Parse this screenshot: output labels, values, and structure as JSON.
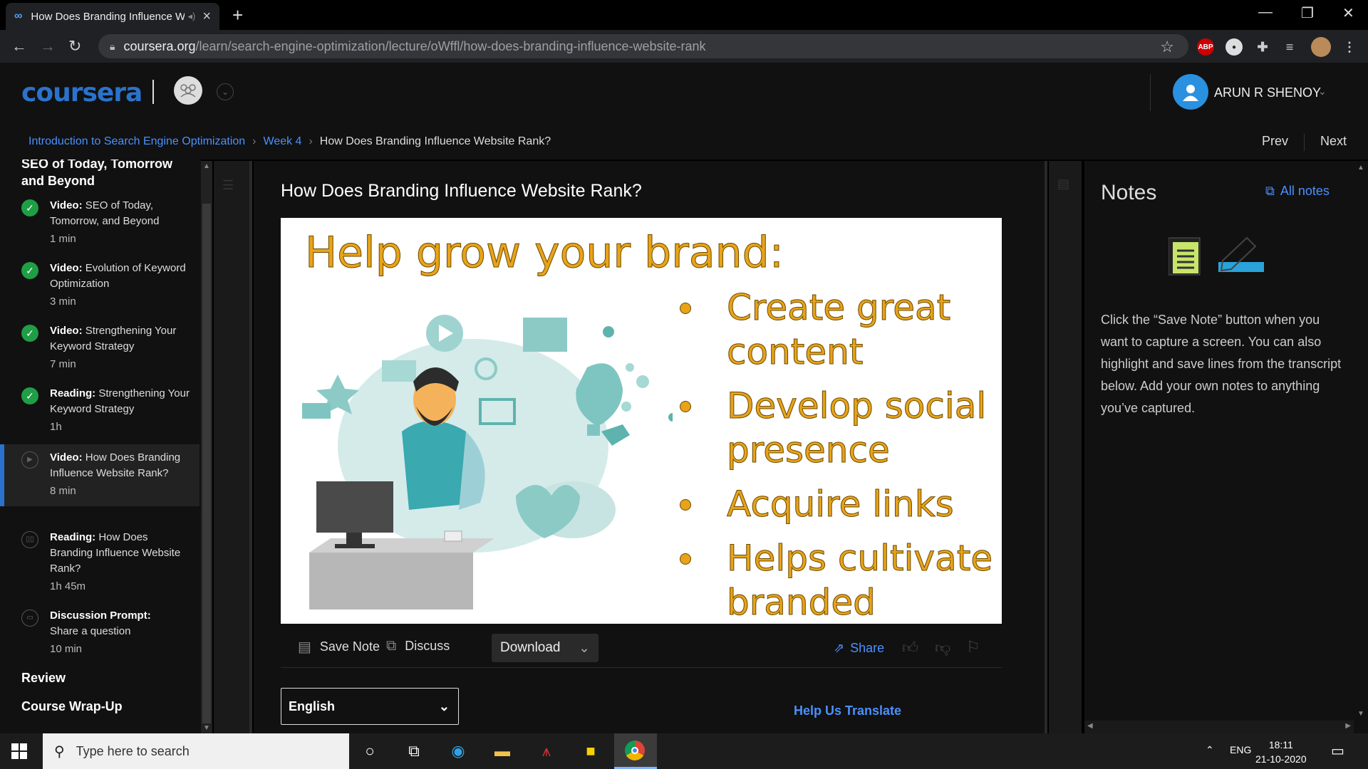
{
  "browser": {
    "tab_title": "How Does Branding Influence Website Rank?",
    "tab_favicon": "coursera-icon",
    "url_host": "coursera.org",
    "url_path": "/learn/search-engine-optimization/lecture/oWffl/how-does-branding-influence-website-rank",
    "ext_abp": "ABP"
  },
  "header": {
    "logo": "coursera",
    "user_name": "ARUN R SHENOY"
  },
  "breadcrumb": {
    "course": "Introduction to Search Engine Optimization",
    "week": "Week 4",
    "current": "How Does Branding Influence Website Rank?",
    "sep": "›",
    "prev": "Prev",
    "next": "Next"
  },
  "sidebar": {
    "section_title": "SEO of Today, Tomorrow and Beyond",
    "items": [
      {
        "type": "Video:",
        "title": "SEO of Today, Tomorrow, and Beyond",
        "duration": "1 min",
        "status": "done"
      },
      {
        "type": "Video:",
        "title": "Evolution of Keyword Optimization",
        "duration": "3 min",
        "status": "done"
      },
      {
        "type": "Video:",
        "title": "Strengthening Your Keyword Strategy",
        "duration": "7 min",
        "status": "done"
      },
      {
        "type": "Reading:",
        "title": "Strengthening Your Keyword Strategy",
        "duration": "1h",
        "status": "done"
      },
      {
        "type": "Video:",
        "title": "How Does Branding Influence Website Rank?",
        "duration": "8 min",
        "status": "active"
      },
      {
        "type": "Reading:",
        "title": "How Does Branding Influence Website Rank?",
        "duration": "1h 45m",
        "status": "todo"
      },
      {
        "type": "Discussion Prompt:",
        "title": "Share a question",
        "duration": "10 min",
        "status": "todo"
      }
    ],
    "sections": [
      "Review",
      "Course Wrap-Up"
    ]
  },
  "lecture": {
    "title": "How Does Branding Influence Website Rank?",
    "slide": {
      "headline": "Help grow your brand:",
      "bullets": [
        "Create great content",
        "Develop social presence",
        "Acquire links",
        "Helps cultivate branded search"
      ]
    },
    "toolbar": {
      "save_note": "Save Note",
      "discuss": "Discuss",
      "download": "Download",
      "share": "Share"
    },
    "language": "English",
    "help_translate": "Help Us Translate"
  },
  "notes": {
    "title": "Notes",
    "all_notes": "All notes",
    "instructions": "Click the “Save Note” button when you want to capture a screen. You can also highlight and save lines from the transcript below. Add your own notes to anything you’ve captured."
  },
  "taskbar": {
    "search_placeholder": "Type here to search",
    "lang": "ENG",
    "time": "18:11",
    "date": "21-10-2020"
  },
  "colors": {
    "accent_blue": "#2a73cc",
    "link_blue": "#4a90ff",
    "slide_gold": "#e8a319",
    "done_green": "#1f9e46"
  }
}
